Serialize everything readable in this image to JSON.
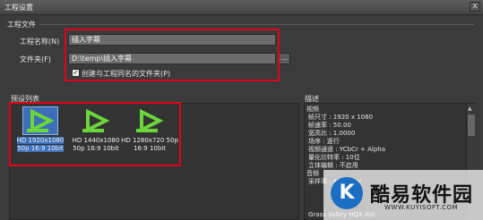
{
  "window": {
    "title": "工程设置",
    "close_label": "x"
  },
  "project_file": {
    "group_label": "工程文件",
    "name_label": "工程名称(N)",
    "name_value": "插入字幕",
    "folder_label": "文件夹(F)",
    "folder_value": "D:\\temp\\插入字幕",
    "browse_label": "...",
    "create_folder_checked": true,
    "create_folder_label": "创建与工程同名的文件夹(P)"
  },
  "preset_list": {
    "label": "预设列表",
    "items": [
      {
        "line1": "HD 1920x1080",
        "line2": "50p 16:9 10bit",
        "selected": true
      },
      {
        "line1": "HD 1440x1080",
        "line2": "50p 16:9 10bit",
        "selected": false
      },
      {
        "line1": "HD 1280x720 50p",
        "line2": "16:9 10bit",
        "selected": false
      }
    ],
    "icon_name": "edius-preset-icon",
    "icon_color": "#6ad63a"
  },
  "description": {
    "label": "描述",
    "lines": [
      "视频",
      "帧尺寸 : 1920 x 1080",
      "帧速率 : 50.00",
      "宽高比 : 1.0000",
      "场序 : 逐行",
      "视频通道 : YCbCr + Alpha",
      "量化比特率 : 10位",
      "立体编辑 : 不启用",
      "音频",
      "采样率 : 48000Hz",
      "Grass Valley HQX AVI"
    ]
  },
  "watermark": {
    "logo_letter": "K",
    "text": "酷易软件园",
    "url": "WWW.KUYISOFT.COM"
  },
  "colors": {
    "accent_red": "#e0001b",
    "selection_blue": "#3d6fb8"
  }
}
